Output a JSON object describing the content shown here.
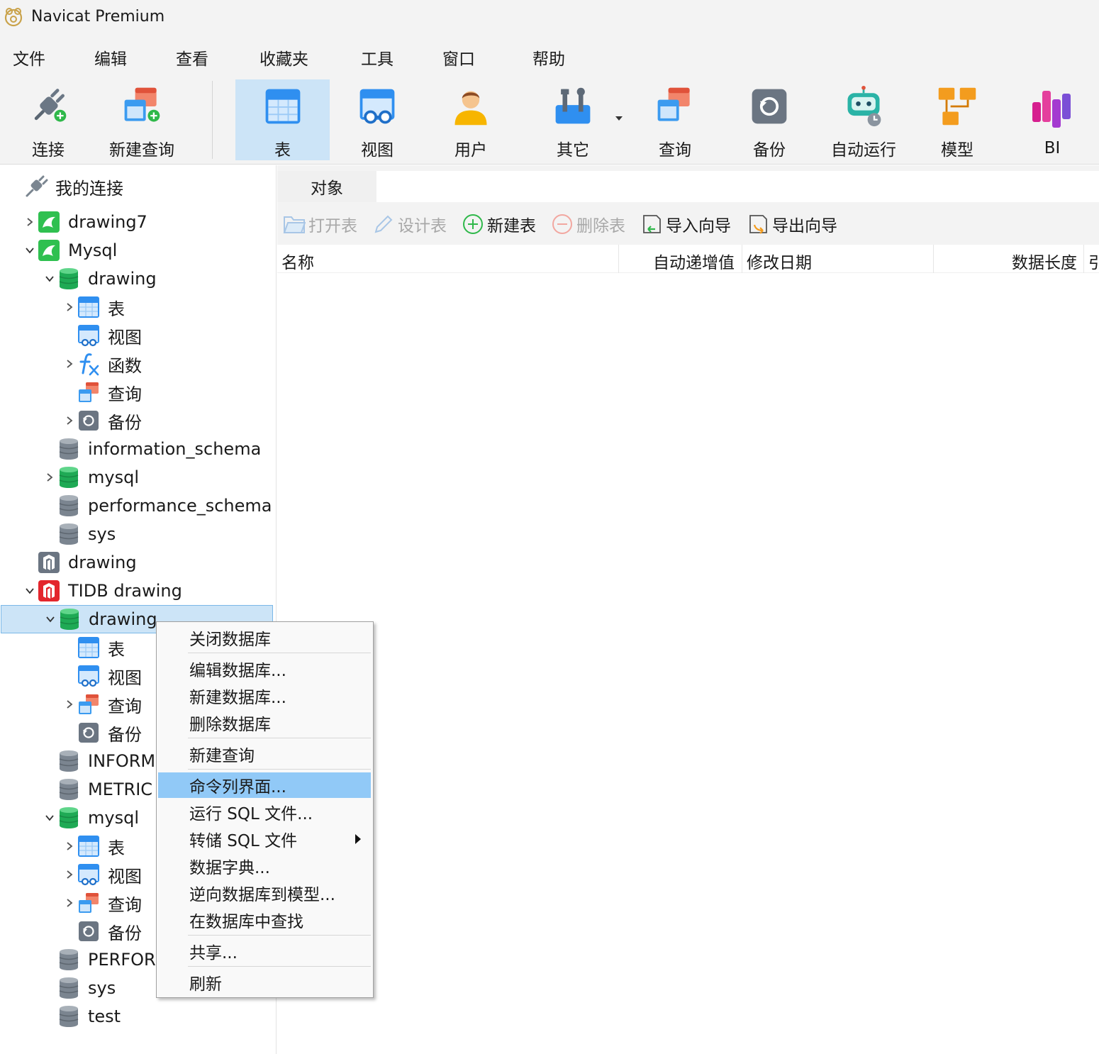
{
  "window": {
    "title": "Navicat Premium"
  },
  "menubar": [
    "文件",
    "编辑",
    "查看",
    "收藏夹",
    "工具",
    "窗口",
    "帮助"
  ],
  "toolbar": {
    "connect": "连接",
    "new_query": "新建查询",
    "table": "表",
    "view": "视图",
    "user": "用户",
    "other": "其它",
    "query": "查询",
    "backup": "备份",
    "automation": "自动运行",
    "model": "模型",
    "bi": "BI"
  },
  "tree": {
    "root": "我的连接",
    "nodes": [
      "drawing7",
      "Mysql",
      "drawing",
      "表",
      "视图",
      "函数",
      "查询",
      "备份",
      "information_schema",
      "mysql",
      "performance_schema",
      "sys",
      "drawing",
      "TIDB drawing",
      "drawing",
      "表",
      "视图",
      "查询",
      "备份",
      "INFORM",
      "METRIC",
      "mysql",
      "表",
      "视图",
      "查询",
      "备份",
      "PERFOR",
      "sys",
      "test"
    ]
  },
  "pane": {
    "tab": "对象",
    "actions": {
      "open_table": "打开表",
      "design_table": "设计表",
      "new_table": "新建表",
      "delete_table": "删除表",
      "import_wizard": "导入向导",
      "export_wizard": "导出向导"
    },
    "columns": [
      "名称",
      "自动递增值",
      "修改日期",
      "数据长度",
      "引"
    ]
  },
  "context_menu": {
    "items": [
      "关闭数据库",
      "编辑数据库...",
      "新建数据库...",
      "删除数据库",
      "新建查询",
      "命令列界面...",
      "运行 SQL 文件...",
      "转储 SQL 文件",
      "数据字典...",
      "逆向数据库到模型...",
      "在数据库中查找",
      "共享...",
      "刷新"
    ],
    "highlighted": "命令列界面..."
  }
}
